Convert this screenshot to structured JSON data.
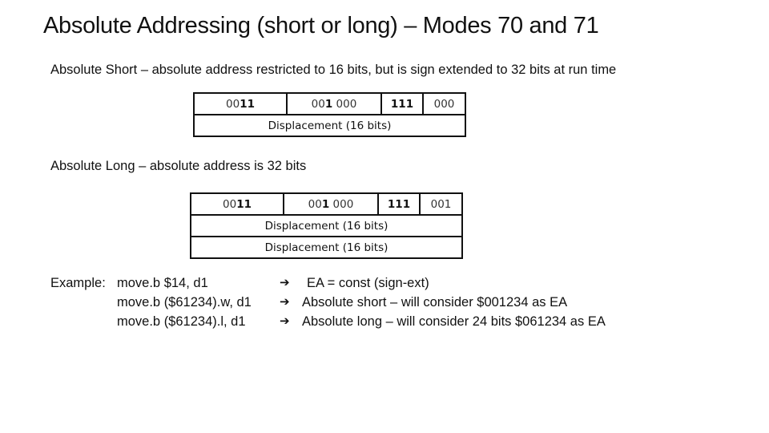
{
  "title": "Absolute Addressing (short or long) – Modes 70 and 71",
  "absolute_short": {
    "description": "Absolute Short – absolute address restricted to 16 bits, but is sign extended to 32 bits at run time",
    "table": {
      "row1": [
        {
          "normal": "00",
          "bold": "11"
        },
        {
          "normal_pre": "00",
          "bold": "1",
          "normal_post": " 000"
        },
        {
          "bold": "111"
        },
        {
          "normal": "000"
        }
      ],
      "extension_rows": [
        "Displacement (16 bits)"
      ]
    }
  },
  "absolute_long": {
    "description": "Absolute Long – absolute address is 32 bits",
    "table": {
      "row1": [
        {
          "normal": "00",
          "bold": "11"
        },
        {
          "normal_pre": "00",
          "bold": "1",
          "normal_post": " 000"
        },
        {
          "bold": "111"
        },
        {
          "normal": "001"
        }
      ],
      "extension_rows": [
        "Displacement (16 bits)",
        "Displacement (16 bits)"
      ]
    }
  },
  "example": {
    "label": "Example:",
    "arrow_icon": "➔",
    "rows": [
      {
        "code": "move.b $14, d1",
        "result": "EA = const (sign-ext)"
      },
      {
        "code": "move.b ($61234).w, d1",
        "result": "Absolute short – will consider $001234 as EA"
      },
      {
        "code": "move.b ($61234).l, d1",
        "result": "Absolute long – will consider 24 bits $061234 as EA"
      }
    ]
  }
}
